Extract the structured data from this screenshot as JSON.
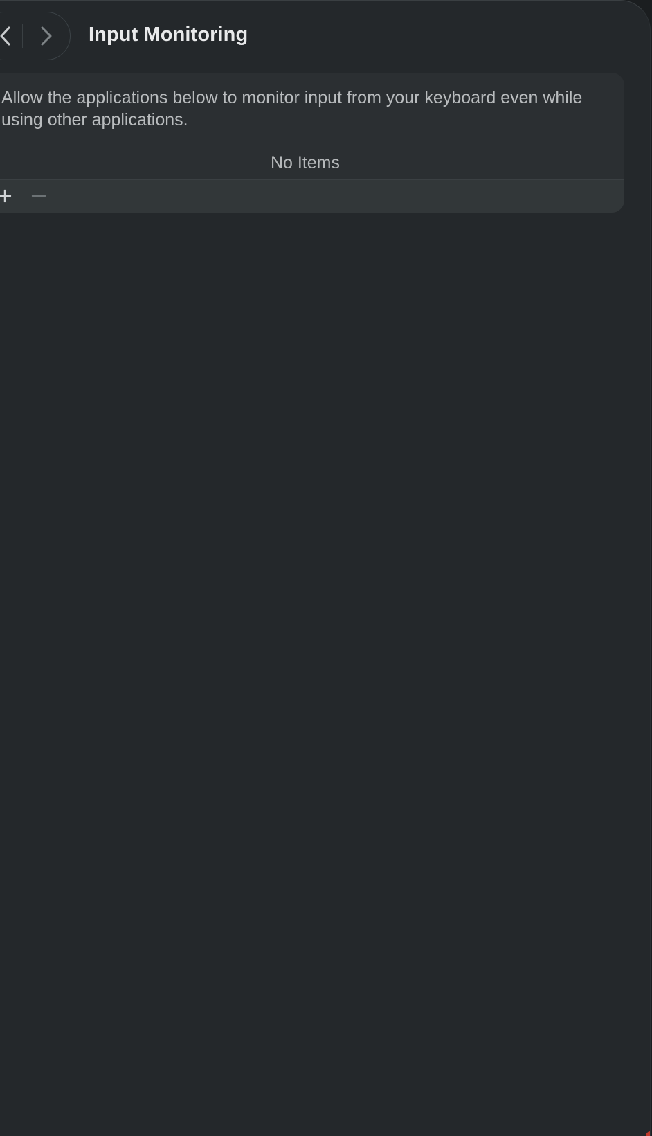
{
  "header": {
    "title": "Input Monitoring",
    "back_icon": "chevron-left-icon",
    "forward_icon": "chevron-right-icon"
  },
  "panel": {
    "description": "Allow the applications below to monitor input from your keyboard even while using other applications.",
    "empty_label": "No Items",
    "add_icon": "plus-icon",
    "remove_icon": "minus-icon"
  },
  "colors": {
    "window_background": "#24282b",
    "panel_background": "#2b2f32",
    "toolbar_background": "#323739",
    "title_text": "#e9eaeb",
    "body_text": "#b9bcbe"
  }
}
